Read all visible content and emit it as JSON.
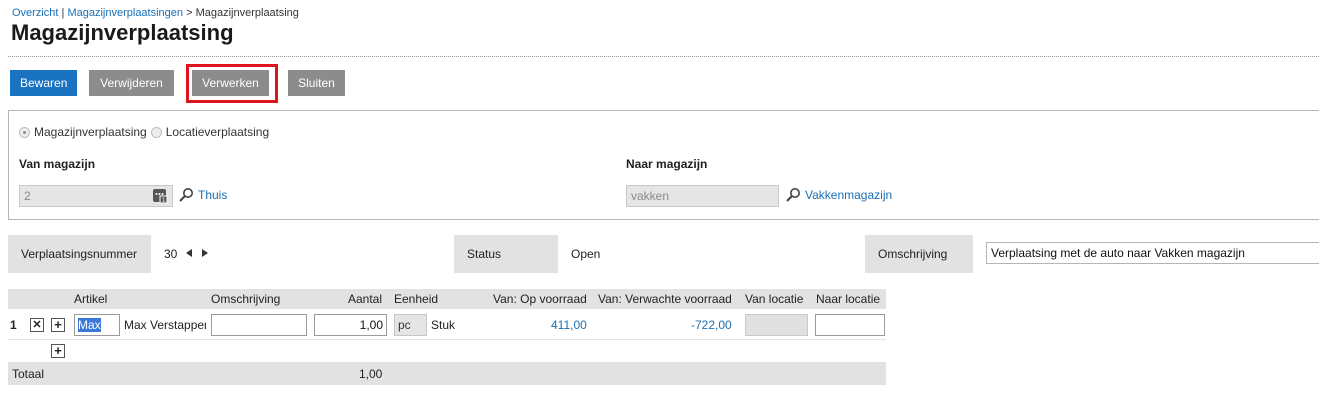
{
  "breadcrumb": {
    "link1": "Overzicht",
    "sep1": " | ",
    "link2": "Magazijnverplaatsingen",
    "sep2": " > ",
    "current": "Magazijnverplaatsing"
  },
  "page_title": "Magazijnverplaatsing",
  "toolbar": {
    "save": "Bewaren",
    "delete": "Verwijderen",
    "process": "Verwerken",
    "close": "Sluiten"
  },
  "move_type": {
    "option1": "Magazijnverplaatsing",
    "option2": "Locatieverplaatsing",
    "selected": "Magazijnverplaatsing"
  },
  "from_warehouse": {
    "label": "Van magazijn",
    "value": "2",
    "name": "Thuis"
  },
  "to_warehouse": {
    "label": "Naar magazijn",
    "value": "vakken",
    "name": "Vakkenmagazijn"
  },
  "header_fields": {
    "number_label": "Verplaatsingsnummer",
    "number_value": "30",
    "status_label": "Status",
    "status_value": "Open",
    "description_label": "Omschrijving",
    "description_value": "Verplaatsing met de auto naar Vakken magazijn"
  },
  "grid": {
    "columns": [
      "Artikel",
      "Omschrijving",
      "Aantal",
      "Eenheid",
      "Van: Op voorraad",
      "Van: Verwachte voorraad",
      "Van locatie",
      "Naar locatie"
    ],
    "rows": [
      {
        "line": "1",
        "article": "Max",
        "article_name": "Max Verstappen",
        "description": "",
        "quantity": "1,00",
        "unit_code": "pc",
        "unit_name": "Stuk",
        "in_stock": "411,00",
        "expected_stock": "-722,00",
        "from_location": "",
        "to_location": ""
      }
    ],
    "total_label": "Totaal",
    "total_quantity": "1,00"
  }
}
